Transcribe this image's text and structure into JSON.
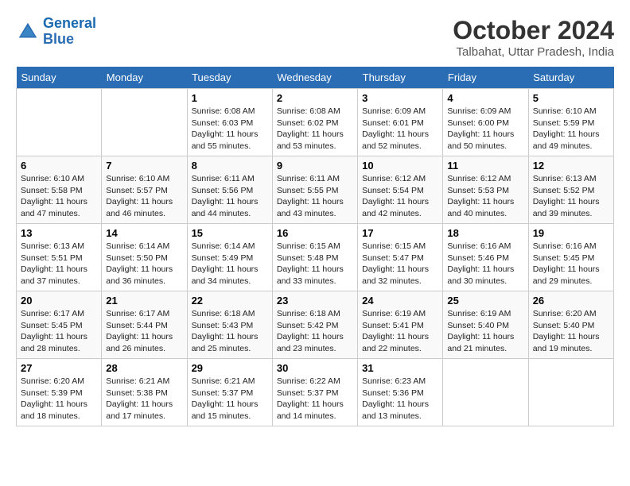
{
  "logo": {
    "line1": "General",
    "line2": "Blue"
  },
  "title": "October 2024",
  "location": "Talbahat, Uttar Pradesh, India",
  "weekdays": [
    "Sunday",
    "Monday",
    "Tuesday",
    "Wednesday",
    "Thursday",
    "Friday",
    "Saturday"
  ],
  "days": [
    {
      "date": "",
      "sunrise": "",
      "sunset": "",
      "daylight": ""
    },
    {
      "date": "",
      "sunrise": "",
      "sunset": "",
      "daylight": ""
    },
    {
      "date": "1",
      "sunrise": "Sunrise: 6:08 AM",
      "sunset": "Sunset: 6:03 PM",
      "daylight": "Daylight: 11 hours and 55 minutes."
    },
    {
      "date": "2",
      "sunrise": "Sunrise: 6:08 AM",
      "sunset": "Sunset: 6:02 PM",
      "daylight": "Daylight: 11 hours and 53 minutes."
    },
    {
      "date": "3",
      "sunrise": "Sunrise: 6:09 AM",
      "sunset": "Sunset: 6:01 PM",
      "daylight": "Daylight: 11 hours and 52 minutes."
    },
    {
      "date": "4",
      "sunrise": "Sunrise: 6:09 AM",
      "sunset": "Sunset: 6:00 PM",
      "daylight": "Daylight: 11 hours and 50 minutes."
    },
    {
      "date": "5",
      "sunrise": "Sunrise: 6:10 AM",
      "sunset": "Sunset: 5:59 PM",
      "daylight": "Daylight: 11 hours and 49 minutes."
    },
    {
      "date": "6",
      "sunrise": "Sunrise: 6:10 AM",
      "sunset": "Sunset: 5:58 PM",
      "daylight": "Daylight: 11 hours and 47 minutes."
    },
    {
      "date": "7",
      "sunrise": "Sunrise: 6:10 AM",
      "sunset": "Sunset: 5:57 PM",
      "daylight": "Daylight: 11 hours and 46 minutes."
    },
    {
      "date": "8",
      "sunrise": "Sunrise: 6:11 AM",
      "sunset": "Sunset: 5:56 PM",
      "daylight": "Daylight: 11 hours and 44 minutes."
    },
    {
      "date": "9",
      "sunrise": "Sunrise: 6:11 AM",
      "sunset": "Sunset: 5:55 PM",
      "daylight": "Daylight: 11 hours and 43 minutes."
    },
    {
      "date": "10",
      "sunrise": "Sunrise: 6:12 AM",
      "sunset": "Sunset: 5:54 PM",
      "daylight": "Daylight: 11 hours and 42 minutes."
    },
    {
      "date": "11",
      "sunrise": "Sunrise: 6:12 AM",
      "sunset": "Sunset: 5:53 PM",
      "daylight": "Daylight: 11 hours and 40 minutes."
    },
    {
      "date": "12",
      "sunrise": "Sunrise: 6:13 AM",
      "sunset": "Sunset: 5:52 PM",
      "daylight": "Daylight: 11 hours and 39 minutes."
    },
    {
      "date": "13",
      "sunrise": "Sunrise: 6:13 AM",
      "sunset": "Sunset: 5:51 PM",
      "daylight": "Daylight: 11 hours and 37 minutes."
    },
    {
      "date": "14",
      "sunrise": "Sunrise: 6:14 AM",
      "sunset": "Sunset: 5:50 PM",
      "daylight": "Daylight: 11 hours and 36 minutes."
    },
    {
      "date": "15",
      "sunrise": "Sunrise: 6:14 AM",
      "sunset": "Sunset: 5:49 PM",
      "daylight": "Daylight: 11 hours and 34 minutes."
    },
    {
      "date": "16",
      "sunrise": "Sunrise: 6:15 AM",
      "sunset": "Sunset: 5:48 PM",
      "daylight": "Daylight: 11 hours and 33 minutes."
    },
    {
      "date": "17",
      "sunrise": "Sunrise: 6:15 AM",
      "sunset": "Sunset: 5:47 PM",
      "daylight": "Daylight: 11 hours and 32 minutes."
    },
    {
      "date": "18",
      "sunrise": "Sunrise: 6:16 AM",
      "sunset": "Sunset: 5:46 PM",
      "daylight": "Daylight: 11 hours and 30 minutes."
    },
    {
      "date": "19",
      "sunrise": "Sunrise: 6:16 AM",
      "sunset": "Sunset: 5:45 PM",
      "daylight": "Daylight: 11 hours and 29 minutes."
    },
    {
      "date": "20",
      "sunrise": "Sunrise: 6:17 AM",
      "sunset": "Sunset: 5:45 PM",
      "daylight": "Daylight: 11 hours and 28 minutes."
    },
    {
      "date": "21",
      "sunrise": "Sunrise: 6:17 AM",
      "sunset": "Sunset: 5:44 PM",
      "daylight": "Daylight: 11 hours and 26 minutes."
    },
    {
      "date": "22",
      "sunrise": "Sunrise: 6:18 AM",
      "sunset": "Sunset: 5:43 PM",
      "daylight": "Daylight: 11 hours and 25 minutes."
    },
    {
      "date": "23",
      "sunrise": "Sunrise: 6:18 AM",
      "sunset": "Sunset: 5:42 PM",
      "daylight": "Daylight: 11 hours and 23 minutes."
    },
    {
      "date": "24",
      "sunrise": "Sunrise: 6:19 AM",
      "sunset": "Sunset: 5:41 PM",
      "daylight": "Daylight: 11 hours and 22 minutes."
    },
    {
      "date": "25",
      "sunrise": "Sunrise: 6:19 AM",
      "sunset": "Sunset: 5:40 PM",
      "daylight": "Daylight: 11 hours and 21 minutes."
    },
    {
      "date": "26",
      "sunrise": "Sunrise: 6:20 AM",
      "sunset": "Sunset: 5:40 PM",
      "daylight": "Daylight: 11 hours and 19 minutes."
    },
    {
      "date": "27",
      "sunrise": "Sunrise: 6:20 AM",
      "sunset": "Sunset: 5:39 PM",
      "daylight": "Daylight: 11 hours and 18 minutes."
    },
    {
      "date": "28",
      "sunrise": "Sunrise: 6:21 AM",
      "sunset": "Sunset: 5:38 PM",
      "daylight": "Daylight: 11 hours and 17 minutes."
    },
    {
      "date": "29",
      "sunrise": "Sunrise: 6:21 AM",
      "sunset": "Sunset: 5:37 PM",
      "daylight": "Daylight: 11 hours and 15 minutes."
    },
    {
      "date": "30",
      "sunrise": "Sunrise: 6:22 AM",
      "sunset": "Sunset: 5:37 PM",
      "daylight": "Daylight: 11 hours and 14 minutes."
    },
    {
      "date": "31",
      "sunrise": "Sunrise: 6:23 AM",
      "sunset": "Sunset: 5:36 PM",
      "daylight": "Daylight: 11 hours and 13 minutes."
    },
    {
      "date": "",
      "sunrise": "",
      "sunset": "",
      "daylight": ""
    },
    {
      "date": "",
      "sunrise": "",
      "sunset": "",
      "daylight": ""
    }
  ]
}
